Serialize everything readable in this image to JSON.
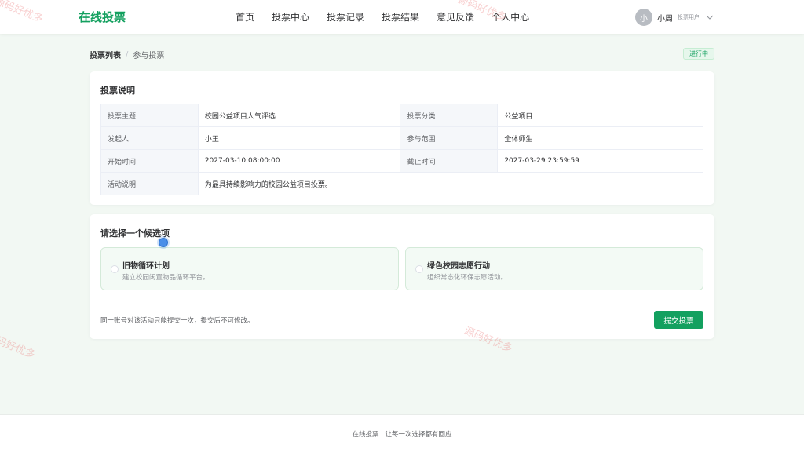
{
  "header": {
    "logo": "在线投票",
    "nav": [
      "首页",
      "投票中心",
      "投票记录",
      "投票结果",
      "意见反馈",
      "个人中心"
    ],
    "user": {
      "avatar_text": "小",
      "name": "小周",
      "role": "投票用户"
    }
  },
  "breadcrumb": {
    "parent": "投票列表",
    "separator": "/",
    "current": "参与投票"
  },
  "status_badge": {
    "text": "进行中",
    "color": "#13a05f"
  },
  "info_card": {
    "title": "投票说明",
    "rows": [
      {
        "label1": "投票主题",
        "value1": "校园公益项目人气评选",
        "label2": "投票分类",
        "value2": "公益项目"
      },
      {
        "label1": "发起人",
        "value1": "小王",
        "label2": "参与范围",
        "value2": "全体师生"
      },
      {
        "label1": "开始时间",
        "value1": "2027-03-10 08:00:00",
        "label2": "截止时间",
        "value2": "2027-03-29 23:59:59"
      }
    ],
    "desc_row": {
      "label": "活动说明",
      "value": "为最具持续影响力的校园公益项目投票。"
    }
  },
  "vote_card": {
    "title": "请选择一个候选项",
    "options": [
      {
        "title": "旧物循环计划",
        "desc": "建立校园闲置物品循环平台。"
      },
      {
        "title": "绿色校园志愿行动",
        "desc": "组织常态化环保志愿活动。"
      }
    ],
    "note": "同一账号对该活动只能提交一次，提交后不可修改。",
    "submit_label": "提交投票"
  },
  "footer": {
    "text": "在线投票 · 让每一次选择都有回应"
  },
  "watermark": "源码好优多",
  "colors": {
    "accent": "#13a05f",
    "background": "#f2f8f3"
  }
}
